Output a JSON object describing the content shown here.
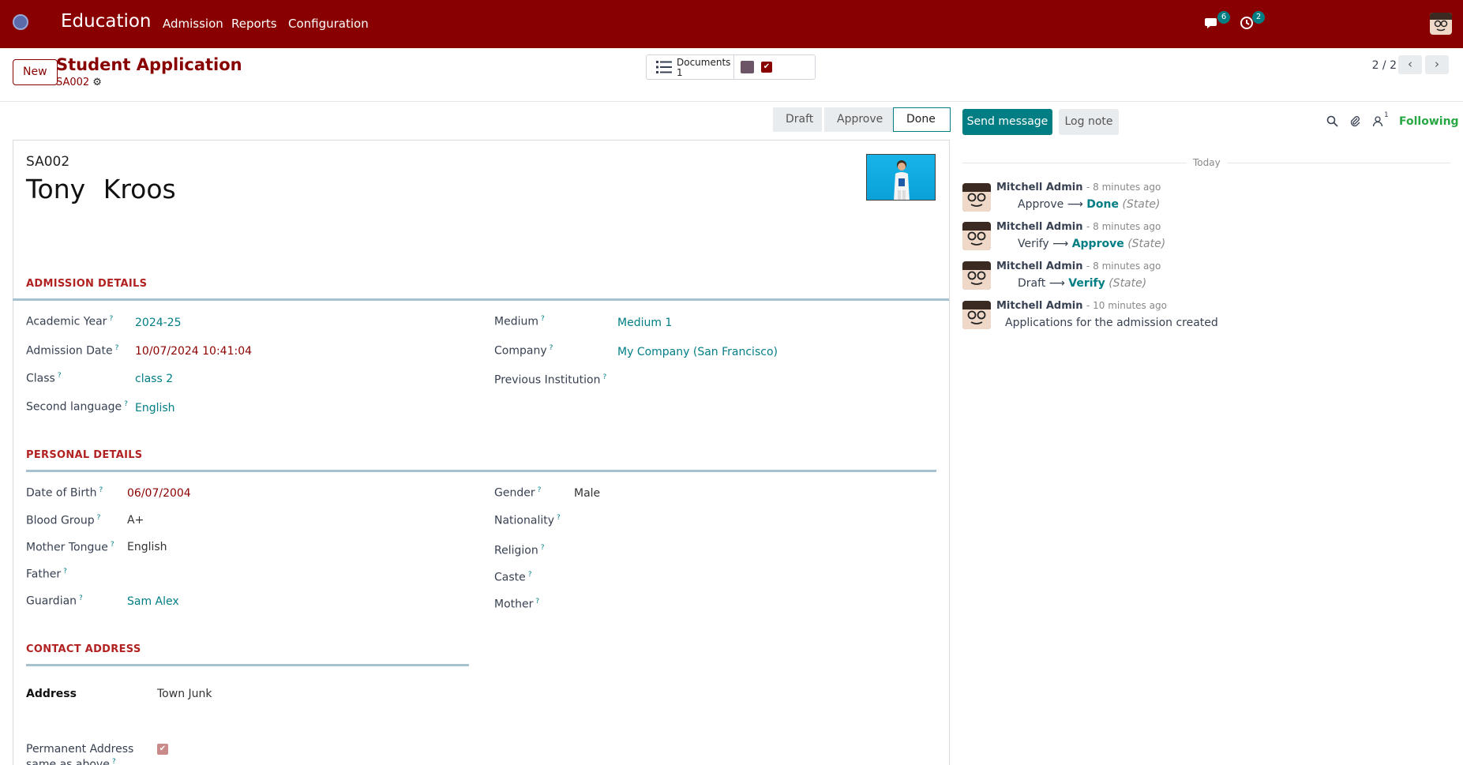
{
  "navbar": {
    "brand": "Education",
    "menu": [
      "Admission",
      "Reports",
      "Configuration"
    ],
    "messages_count": "6",
    "activities_count": "2"
  },
  "control": {
    "new_label": "New",
    "title": "Student Application",
    "record_ref": "SA002",
    "documents_label": "Documents",
    "documents_count": "1",
    "pager": "2 / 2"
  },
  "status": {
    "stages": [
      "Draft",
      "Approve",
      "Done"
    ],
    "active": "Done"
  },
  "form": {
    "ref": "SA002",
    "first_name": "Tony",
    "last_name": "Kroos",
    "sections": {
      "admission": "ADMISSION DETAILS",
      "personal": "PERSONAL DETAILS",
      "contact": "CONTACT ADDRESS"
    },
    "help_mark": "?",
    "admission": {
      "academic_year_label": "Academic Year",
      "academic_year": "2024-25",
      "admission_date_label": "Admission Date",
      "admission_date": "10/07/2024 10:41:04",
      "class_label": "Class",
      "class": "class 2",
      "second_language_label": "Second language",
      "second_language": "English",
      "medium_label": "Medium",
      "medium": "Medium 1",
      "company_label": "Company",
      "company": "My Company (San Francisco)",
      "previous_institution_label": "Previous Institution"
    },
    "personal": {
      "dob_label": "Date of Birth",
      "dob": "06/07/2004",
      "blood_group_label": "Blood Group",
      "blood_group": "A+",
      "mother_tongue_label": "Mother Tongue",
      "mother_tongue": "English",
      "father_label": "Father",
      "guardian_label": "Guardian",
      "guardian": "Sam Alex",
      "gender_label": "Gender",
      "gender": "Male",
      "nationality_label": "Nationality",
      "religion_label": "Religion",
      "caste_label": "Caste",
      "mother_label": "Mother"
    },
    "contact": {
      "address_label": "Address",
      "address": "Town Junk",
      "permanent_label_1": "Permanent Address",
      "permanent_label_2": "same as above"
    }
  },
  "chatter": {
    "send_message": "Send message",
    "log_note": "Log note",
    "followers_count": "1",
    "following": "Following",
    "today": "Today",
    "messages": [
      {
        "author": "Mitchell Admin",
        "time": "- 8 minutes ago",
        "old": "Approve",
        "new": "Done",
        "field": "(State)"
      },
      {
        "author": "Mitchell Admin",
        "time": "- 8 minutes ago",
        "old": "Verify",
        "new": "Approve",
        "field": "(State)"
      },
      {
        "author": "Mitchell Admin",
        "time": "- 8 minutes ago",
        "old": "Draft",
        "new": "Verify",
        "field": "(State)"
      },
      {
        "author": "Mitchell Admin",
        "time": "- 10 minutes ago",
        "text": "Applications for the admission created"
      }
    ]
  }
}
